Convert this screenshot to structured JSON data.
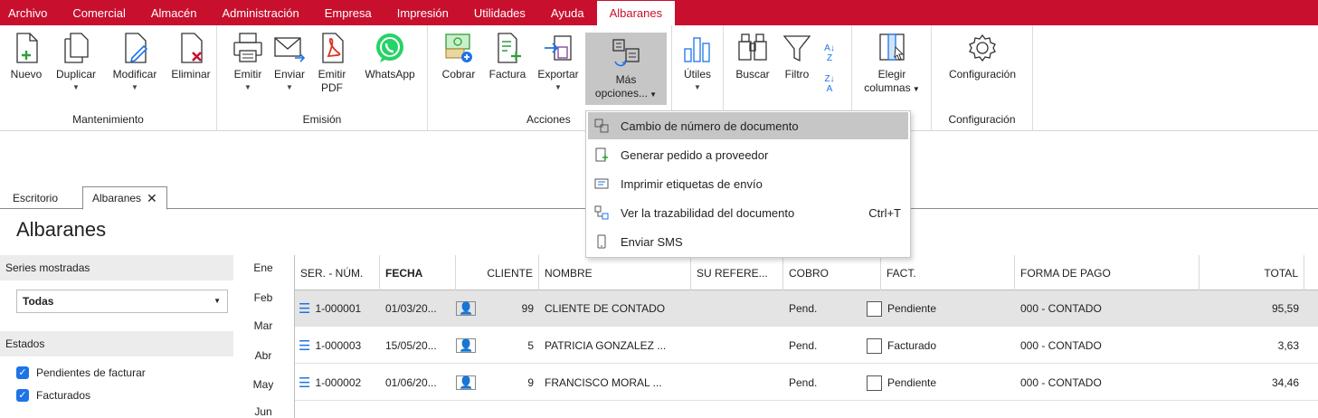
{
  "menubar": {
    "items": [
      "Archivo",
      "Comercial",
      "Almacén",
      "Administración",
      "Empresa",
      "Impresión",
      "Utilidades",
      "Ayuda",
      "Albaranes"
    ]
  },
  "ribbon": {
    "groups": {
      "mantenimiento": "Mantenimiento",
      "emision": "Emisión",
      "acciones": "Acciones",
      "configuracion": "Configuración"
    },
    "buttons": {
      "nuevo": "Nuevo",
      "duplicar": "Duplicar",
      "modificar": "Modificar",
      "eliminar": "Eliminar",
      "emitir": "Emitir",
      "enviar": "Enviar",
      "emitir_pdf_1": "Emitir",
      "emitir_pdf_2": "PDF",
      "whatsapp": "WhatsApp",
      "cobrar": "Cobrar",
      "factura": "Factura",
      "exportar": "Exportar",
      "mas_1": "Más",
      "mas_2": "opciones...",
      "utiles": "Útiles",
      "buscar": "Buscar",
      "filtro": "Filtro",
      "elegir_1": "Elegir",
      "elegir_2": "columnas",
      "configuracion": "Configuración"
    }
  },
  "dropdown": {
    "items": [
      {
        "label": "Cambio de número de documento",
        "shortcut": ""
      },
      {
        "label": "Generar pedido a proveedor",
        "shortcut": ""
      },
      {
        "label": "Imprimir etiquetas de envío",
        "shortcut": ""
      },
      {
        "label": "Ver la trazabilidad del documento",
        "shortcut": "Ctrl+T"
      },
      {
        "label": "Enviar SMS",
        "shortcut": ""
      }
    ]
  },
  "tabs": {
    "escritorio": "Escritorio",
    "albaranes": "Albaranes"
  },
  "page_title": "Albaranes",
  "left_panel": {
    "series_head": "Series mostradas",
    "series_value": "Todas",
    "estados_head": "Estados",
    "estados": [
      "Pendientes de facturar",
      "Facturados"
    ]
  },
  "months": [
    "Ene",
    "Feb",
    "Mar",
    "Abr",
    "May",
    "Jun"
  ],
  "grid": {
    "headers": {
      "ser_num": "SER. - NÚM.",
      "fecha": "FECHA",
      "cliente": "CLIENTE",
      "nombre": "NOMBRE",
      "su_ref": "SU REFERE...",
      "cobro": "COBRO",
      "fact": "FACT.",
      "forma_pago": "FORMA DE PAGO",
      "total": "TOTAL"
    },
    "rows": [
      {
        "num": "1-000001",
        "fecha": "01/03/20...",
        "cliente": "99",
        "nombre": "CLIENTE DE CONTADO",
        "cobro": "Pend.",
        "fact": "Pendiente",
        "forma": "000 - CONTADO",
        "total": "95,59"
      },
      {
        "num": "1-000003",
        "fecha": "15/05/20...",
        "cliente": "5",
        "nombre": "PATRICIA GONZALEZ ...",
        "cobro": "Pend.",
        "fact": "Facturado",
        "forma": "000 - CONTADO",
        "total": "3,63"
      },
      {
        "num": "1-000002",
        "fecha": "01/06/20...",
        "cliente": "9",
        "nombre": "FRANCISCO MORAL ...",
        "cobro": "Pend.",
        "fact": "Pendiente",
        "forma": "000 - CONTADO",
        "total": "34,46"
      }
    ]
  },
  "colors": {
    "brand": "#c8102e",
    "checkbox": "#1e73e8",
    "highlight": "#c6c6c6",
    "whatsapp": "#25d366",
    "pdf": "#e0301e"
  }
}
